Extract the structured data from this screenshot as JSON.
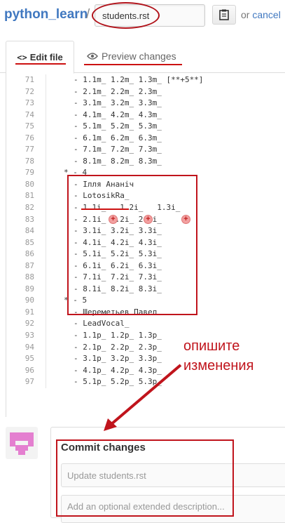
{
  "header": {
    "repo_name": "python_learn",
    "separator": "/",
    "filename": "students.rst",
    "or_text": "or",
    "cancel_label": "cancel"
  },
  "tabs": {
    "edit_label": "Edit file",
    "preview_label": "Preview changes"
  },
  "code_lines": [
    {
      "n": "71",
      "t": "- 1.1m_ 1.2m_ 1.3m_ [**+5**]"
    },
    {
      "n": "72",
      "t": "- 2.1m_ 2.2m_ 2.3m_"
    },
    {
      "n": "73",
      "t": "- 3.1m_ 3.2m_ 3.3m_"
    },
    {
      "n": "74",
      "t": "- 4.1m_ 4.2m_ 4.3m_"
    },
    {
      "n": "75",
      "t": "- 5.1m_ 5.2m_ 5.3m_"
    },
    {
      "n": "76",
      "t": "- 6.1m_ 6.2m_ 6.3m_"
    },
    {
      "n": "77",
      "t": "- 7.1m_ 7.2m_ 7.3m_"
    },
    {
      "n": "78",
      "t": "- 8.1m_ 8.2m_ 8.3m_"
    },
    {
      "n": "79",
      "t": "* - 4"
    },
    {
      "n": "80",
      "t": "- Ілля Ананіч"
    },
    {
      "n": "81",
      "t": "- LotosikRa_"
    },
    {
      "n": "82",
      "t": "- 1.1i_   1.2i_   1.3i_"
    },
    {
      "n": "83",
      "t": "- 2.1i_ 2.2i_ 2.3i_"
    },
    {
      "n": "84",
      "t": "- 3.1i_ 3.2i_ 3.3i_"
    },
    {
      "n": "85",
      "t": "- 4.1i_ 4.2i_ 4.3i_"
    },
    {
      "n": "86",
      "t": "- 5.1i_ 5.2i_ 5.3i_"
    },
    {
      "n": "87",
      "t": "- 6.1i_ 6.2i_ 6.3i_"
    },
    {
      "n": "88",
      "t": "- 7.1i_ 7.2i_ 7.3i_"
    },
    {
      "n": "89",
      "t": "- 8.1i_ 8.2i_ 8.3i_"
    },
    {
      "n": "90",
      "t": "* - 5"
    },
    {
      "n": "91",
      "t": "- Шереметьев Павел"
    },
    {
      "n": "92",
      "t": "- LeadVocal_"
    },
    {
      "n": "93",
      "t": "- 1.1p_ 1.2p_ 1.3p_"
    },
    {
      "n": "94",
      "t": "- 2.1p_ 2.2p_ 2.3p_"
    },
    {
      "n": "95",
      "t": "- 3.1p_ 3.2p_ 3.3p_"
    },
    {
      "n": "96",
      "t": "- 4.1p_ 4.2p_ 4.3p_"
    },
    {
      "n": "97",
      "t": "- 5.1p_ 5.2p_ 5.3p_"
    }
  ],
  "plus_mark": "+",
  "annotation": {
    "line1": "опишите",
    "line2": "изменения"
  },
  "commit": {
    "title": "Commit changes",
    "summary_placeholder": "Update students.rst",
    "description_placeholder": "Add an optional extended description..."
  },
  "icons": {
    "clipboard": "clipboard-icon",
    "code": "code-icon",
    "eye": "eye-icon",
    "avatar": "identicon-avatar"
  },
  "colors": {
    "link": "#4078c0",
    "annotation_red": "#c0141c",
    "avatar_pink": "#e47fd0"
  }
}
